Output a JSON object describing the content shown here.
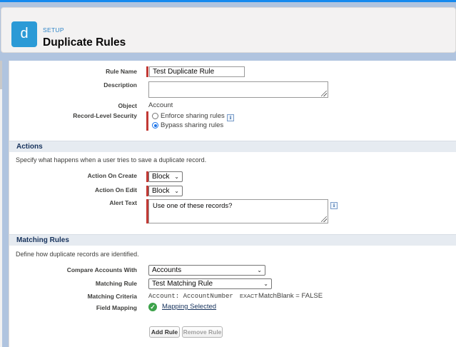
{
  "header": {
    "app_icon_letter": "d",
    "section_label": "SETUP",
    "title": "Duplicate Rules"
  },
  "form": {
    "rule_name_label": "Rule Name",
    "rule_name_value": "Test Duplicate Rule",
    "description_label": "Description",
    "description_value": "",
    "object_label": "Object",
    "object_value": "Account",
    "security_label": "Record-Level Security",
    "security_options": [
      {
        "label": "Enforce sharing rules",
        "selected": false
      },
      {
        "label": "Bypass sharing rules",
        "selected": true
      }
    ]
  },
  "actions": {
    "section_title": "Actions",
    "description": "Specify what happens when a user tries to save a duplicate record.",
    "on_create_label": "Action On Create",
    "on_create_value": "Block",
    "on_edit_label": "Action On Edit",
    "on_edit_value": "Block",
    "alert_text_label": "Alert Text",
    "alert_text_value": "Use one of these records?"
  },
  "matching": {
    "section_title": "Matching Rules",
    "description": "Define how duplicate records are identified.",
    "compare_label": "Compare Accounts With",
    "compare_value": "Accounts",
    "matching_rule_label": "Matching Rule",
    "matching_rule_value": "Test Matching Rule",
    "criteria_label": "Matching Criteria",
    "criteria_field": "Account: AccountNumber",
    "criteria_operator": "EXACT",
    "criteria_rest": "MatchBlank = FALSE",
    "mapping_label": "Field Mapping",
    "mapping_link": "Mapping Selected",
    "add_rule_button": "Add Rule",
    "remove_rule_button": "Remove Rule"
  },
  "icons": {
    "info": "i",
    "check": "✓",
    "caret": "⌄"
  },
  "colors": {
    "required_bar": "#c23934",
    "app_icon": "#2b9ad6",
    "success": "#3ca24a"
  }
}
